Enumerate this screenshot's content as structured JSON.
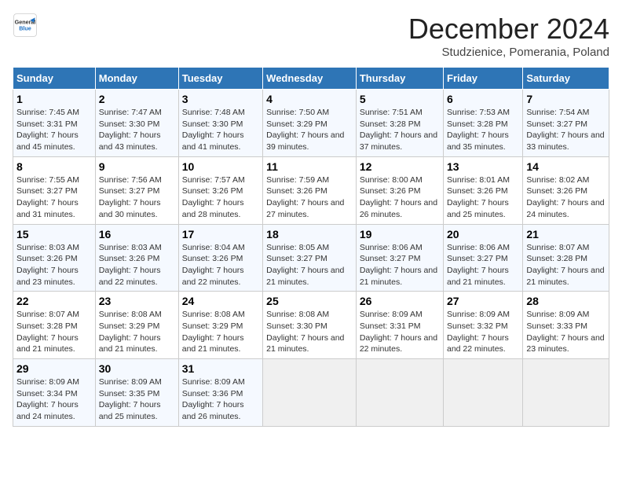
{
  "logo": {
    "line1": "General",
    "line2": "Blue"
  },
  "title": "December 2024",
  "subtitle": "Studzienice, Pomerania, Poland",
  "days_of_week": [
    "Sunday",
    "Monday",
    "Tuesday",
    "Wednesday",
    "Thursday",
    "Friday",
    "Saturday"
  ],
  "weeks": [
    [
      {
        "day": "1",
        "sunrise": "Sunrise: 7:45 AM",
        "sunset": "Sunset: 3:31 PM",
        "daylight": "Daylight: 7 hours and 45 minutes."
      },
      {
        "day": "2",
        "sunrise": "Sunrise: 7:47 AM",
        "sunset": "Sunset: 3:30 PM",
        "daylight": "Daylight: 7 hours and 43 minutes."
      },
      {
        "day": "3",
        "sunrise": "Sunrise: 7:48 AM",
        "sunset": "Sunset: 3:30 PM",
        "daylight": "Daylight: 7 hours and 41 minutes."
      },
      {
        "day": "4",
        "sunrise": "Sunrise: 7:50 AM",
        "sunset": "Sunset: 3:29 PM",
        "daylight": "Daylight: 7 hours and 39 minutes."
      },
      {
        "day": "5",
        "sunrise": "Sunrise: 7:51 AM",
        "sunset": "Sunset: 3:28 PM",
        "daylight": "Daylight: 7 hours and 37 minutes."
      },
      {
        "day": "6",
        "sunrise": "Sunrise: 7:53 AM",
        "sunset": "Sunset: 3:28 PM",
        "daylight": "Daylight: 7 hours and 35 minutes."
      },
      {
        "day": "7",
        "sunrise": "Sunrise: 7:54 AM",
        "sunset": "Sunset: 3:27 PM",
        "daylight": "Daylight: 7 hours and 33 minutes."
      }
    ],
    [
      {
        "day": "8",
        "sunrise": "Sunrise: 7:55 AM",
        "sunset": "Sunset: 3:27 PM",
        "daylight": "Daylight: 7 hours and 31 minutes."
      },
      {
        "day": "9",
        "sunrise": "Sunrise: 7:56 AM",
        "sunset": "Sunset: 3:27 PM",
        "daylight": "Daylight: 7 hours and 30 minutes."
      },
      {
        "day": "10",
        "sunrise": "Sunrise: 7:57 AM",
        "sunset": "Sunset: 3:26 PM",
        "daylight": "Daylight: 7 hours and 28 minutes."
      },
      {
        "day": "11",
        "sunrise": "Sunrise: 7:59 AM",
        "sunset": "Sunset: 3:26 PM",
        "daylight": "Daylight: 7 hours and 27 minutes."
      },
      {
        "day": "12",
        "sunrise": "Sunrise: 8:00 AM",
        "sunset": "Sunset: 3:26 PM",
        "daylight": "Daylight: 7 hours and 26 minutes."
      },
      {
        "day": "13",
        "sunrise": "Sunrise: 8:01 AM",
        "sunset": "Sunset: 3:26 PM",
        "daylight": "Daylight: 7 hours and 25 minutes."
      },
      {
        "day": "14",
        "sunrise": "Sunrise: 8:02 AM",
        "sunset": "Sunset: 3:26 PM",
        "daylight": "Daylight: 7 hours and 24 minutes."
      }
    ],
    [
      {
        "day": "15",
        "sunrise": "Sunrise: 8:03 AM",
        "sunset": "Sunset: 3:26 PM",
        "daylight": "Daylight: 7 hours and 23 minutes."
      },
      {
        "day": "16",
        "sunrise": "Sunrise: 8:03 AM",
        "sunset": "Sunset: 3:26 PM",
        "daylight": "Daylight: 7 hours and 22 minutes."
      },
      {
        "day": "17",
        "sunrise": "Sunrise: 8:04 AM",
        "sunset": "Sunset: 3:26 PM",
        "daylight": "Daylight: 7 hours and 22 minutes."
      },
      {
        "day": "18",
        "sunrise": "Sunrise: 8:05 AM",
        "sunset": "Sunset: 3:27 PM",
        "daylight": "Daylight: 7 hours and 21 minutes."
      },
      {
        "day": "19",
        "sunrise": "Sunrise: 8:06 AM",
        "sunset": "Sunset: 3:27 PM",
        "daylight": "Daylight: 7 hours and 21 minutes."
      },
      {
        "day": "20",
        "sunrise": "Sunrise: 8:06 AM",
        "sunset": "Sunset: 3:27 PM",
        "daylight": "Daylight: 7 hours and 21 minutes."
      },
      {
        "day": "21",
        "sunrise": "Sunrise: 8:07 AM",
        "sunset": "Sunset: 3:28 PM",
        "daylight": "Daylight: 7 hours and 21 minutes."
      }
    ],
    [
      {
        "day": "22",
        "sunrise": "Sunrise: 8:07 AM",
        "sunset": "Sunset: 3:28 PM",
        "daylight": "Daylight: 7 hours and 21 minutes."
      },
      {
        "day": "23",
        "sunrise": "Sunrise: 8:08 AM",
        "sunset": "Sunset: 3:29 PM",
        "daylight": "Daylight: 7 hours and 21 minutes."
      },
      {
        "day": "24",
        "sunrise": "Sunrise: 8:08 AM",
        "sunset": "Sunset: 3:29 PM",
        "daylight": "Daylight: 7 hours and 21 minutes."
      },
      {
        "day": "25",
        "sunrise": "Sunrise: 8:08 AM",
        "sunset": "Sunset: 3:30 PM",
        "daylight": "Daylight: 7 hours and 21 minutes."
      },
      {
        "day": "26",
        "sunrise": "Sunrise: 8:09 AM",
        "sunset": "Sunset: 3:31 PM",
        "daylight": "Daylight: 7 hours and 22 minutes."
      },
      {
        "day": "27",
        "sunrise": "Sunrise: 8:09 AM",
        "sunset": "Sunset: 3:32 PM",
        "daylight": "Daylight: 7 hours and 22 minutes."
      },
      {
        "day": "28",
        "sunrise": "Sunrise: 8:09 AM",
        "sunset": "Sunset: 3:33 PM",
        "daylight": "Daylight: 7 hours and 23 minutes."
      }
    ],
    [
      {
        "day": "29",
        "sunrise": "Sunrise: 8:09 AM",
        "sunset": "Sunset: 3:34 PM",
        "daylight": "Daylight: 7 hours and 24 minutes."
      },
      {
        "day": "30",
        "sunrise": "Sunrise: 8:09 AM",
        "sunset": "Sunset: 3:35 PM",
        "daylight": "Daylight: 7 hours and 25 minutes."
      },
      {
        "day": "31",
        "sunrise": "Sunrise: 8:09 AM",
        "sunset": "Sunset: 3:36 PM",
        "daylight": "Daylight: 7 hours and 26 minutes."
      },
      null,
      null,
      null,
      null
    ]
  ]
}
